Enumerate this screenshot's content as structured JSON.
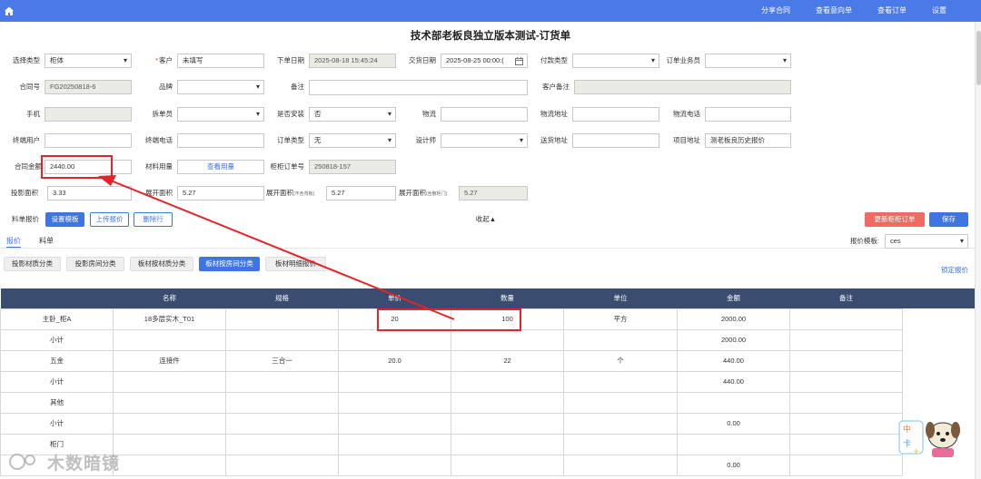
{
  "nav": {
    "links": [
      "分享合同",
      "查看意向单",
      "查看订单",
      "设置"
    ]
  },
  "page_title": "技术部老板良独立版本测试-订货单",
  "form": {
    "select_type": {
      "label": "选择类型",
      "value": "柜体"
    },
    "customer": {
      "required": "*",
      "label": "客户",
      "value": "未填写"
    },
    "order_date": {
      "label": "下单日期",
      "value": "2025-08-18 15:45:24"
    },
    "delivery_date": {
      "label": "交货日期",
      "value": "2025-08-25 00:00:("
    },
    "payment_type": {
      "label": "付款类型",
      "value": ""
    },
    "salesperson": {
      "label": "订单业务员",
      "value": ""
    },
    "contract_no": {
      "label": "合同号",
      "value": "FG20250818-6"
    },
    "brand": {
      "label": "品牌",
      "value": ""
    },
    "remark": {
      "label": "备注",
      "value": ""
    },
    "customer_remark": {
      "label": "客户备注",
      "value": ""
    },
    "phone": {
      "label": "手机",
      "value": ""
    },
    "splitter": {
      "label": "拆单员",
      "value": ""
    },
    "install": {
      "label": "是否安装",
      "value": "否"
    },
    "logistics": {
      "label": "物流",
      "value": ""
    },
    "logistics_address": {
      "label": "物流地址",
      "value": ""
    },
    "logistics_phone": {
      "label": "物流电话",
      "value": ""
    },
    "end_user": {
      "label": "终端用户",
      "value": ""
    },
    "end_phone": {
      "label": "终端电话",
      "value": ""
    },
    "order_type": {
      "label": "订单类型",
      "value": "无"
    },
    "designer": {
      "label": "设计师",
      "value": ""
    },
    "ship_address": {
      "label": "送货地址",
      "value": ""
    },
    "project_address": {
      "label": "项目地址",
      "value": "测老板良历史报价"
    },
    "contract_amount": {
      "label": "合同金额",
      "value": "2440.00"
    },
    "material_usage": {
      "label": "材料用量",
      "value": "查看用量"
    },
    "cabinet_order_no": {
      "label": "柜柜订单号",
      "value": "250818-157"
    },
    "projected_area": {
      "label": "投影面积",
      "value": "3.33"
    },
    "expanded_area": {
      "label": "展开面积",
      "value": "5.27"
    },
    "expanded_area_no_back": {
      "label": "展开面积",
      "note": "(不含背板)",
      "value": "5.27"
    },
    "expanded_area_with_door": {
      "label": "展开面积",
      "note": "(含散柜门)",
      "value": "5.27"
    }
  },
  "toolbar": {
    "quote_label": "料单报价",
    "set_template": "设置模板",
    "upload_quote": "上传报价",
    "delete_row": "删除行",
    "collapse": "收起▲",
    "update_cabinet_order": "更新柜柜订单",
    "save": "保存"
  },
  "tabs": [
    "报价",
    "料单"
  ],
  "quote_template": {
    "label": "报价模板:",
    "value": "ces"
  },
  "category_buttons": [
    "投影材质分类",
    "投影房间分类",
    "板材按材质分类",
    "板材按房间分类",
    "板材明细报价"
  ],
  "lock_quote": "锁定报价",
  "table": {
    "headers": [
      "",
      "名称",
      "规格",
      "单价",
      "数量",
      "单位",
      "金额",
      "备注"
    ],
    "rows": [
      [
        "主卧_柜A",
        "18多层实木_T01",
        "",
        "20",
        "100",
        "平方",
        "2000.00",
        ""
      ],
      [
        "小计",
        "",
        "",
        "",
        "",
        "",
        "2000.00",
        ""
      ],
      [
        "五金",
        "连接件",
        "三合一",
        "20.0",
        "22",
        "个",
        "440.00",
        ""
      ],
      [
        "小计",
        "",
        "",
        "",
        "",
        "",
        "440.00",
        ""
      ],
      [
        "其他",
        "",
        "",
        "",
        "",
        "",
        "",
        ""
      ],
      [
        "小计",
        "",
        "",
        "",
        "",
        "",
        "0.00",
        ""
      ],
      [
        "柜门",
        "",
        "",
        "",
        "",
        "",
        "",
        ""
      ],
      [
        "",
        "",
        "",
        "",
        "",
        "",
        "0.00",
        ""
      ]
    ]
  },
  "watermark": "木数暗镜",
  "colors": {
    "topbar": "#4a7ae8",
    "header": "#3a4d70",
    "accent": "#3f75e0",
    "danger": "#f06a63",
    "annotation": "#e3242b"
  }
}
